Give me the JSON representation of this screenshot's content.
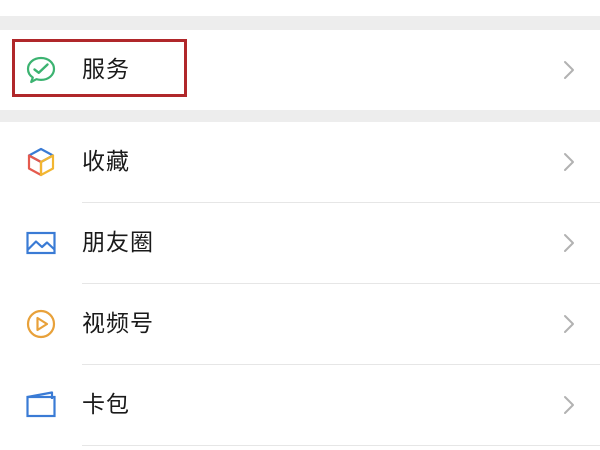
{
  "menu": {
    "service": {
      "label": "服务",
      "icon": "wechat-pay-check-icon",
      "color": "#3cb371"
    },
    "items": [
      {
        "label": "收藏",
        "icon": "favorites-cube-icon"
      },
      {
        "label": "朋友圈",
        "icon": "moments-picture-icon",
        "color": "#3a7bd5"
      },
      {
        "label": "视频号",
        "icon": "channels-play-icon",
        "color": "#e8a13a"
      },
      {
        "label": "卡包",
        "icon": "card-wallet-icon",
        "color": "#3a7bd5"
      }
    ]
  },
  "annotation": {
    "highlight_color": "#b0272a",
    "target": "服务"
  }
}
